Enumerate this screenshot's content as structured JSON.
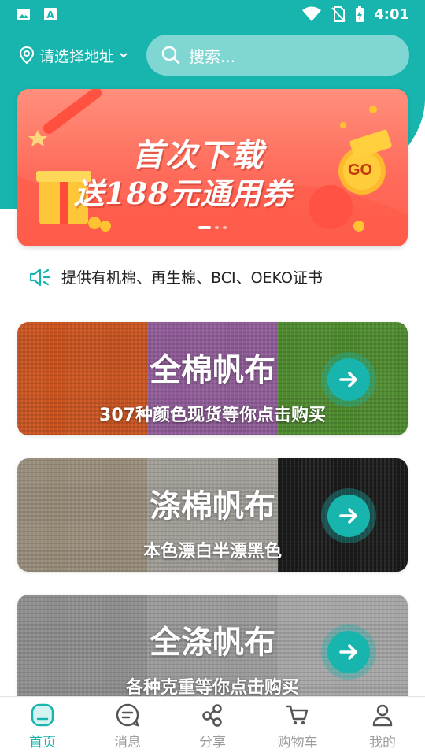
{
  "status_bar": {
    "time": "4:01"
  },
  "header": {
    "location_label": "请选择地址",
    "search_placeholder": "搜索..."
  },
  "banner": {
    "line1": "首次下载",
    "line2": "送188元通用券",
    "badge": "GO",
    "slide_count": 3,
    "active_slide": 0
  },
  "notice": {
    "text": "提供有机棉、再生棉、BCI、OEKO证书"
  },
  "cards": [
    {
      "title": "全棉帆布",
      "subtitle": "307种颜色现货等你点击购买",
      "swatches": [
        "#c9531f",
        "#8e5b97",
        "#4e8a2e"
      ]
    },
    {
      "title": "涤棉帆布",
      "subtitle": "本色漂白半漂黑色",
      "swatches": [
        "#978c7a",
        "#a09d97",
        "#1a1a1a"
      ]
    },
    {
      "title": "全涤帆布",
      "subtitle": "各种克重等你点击购买",
      "swatches": [
        "#8d8d8d",
        "#999999",
        "#a5a5a5"
      ]
    }
  ],
  "tabbar": {
    "items": [
      {
        "label": "首页",
        "icon": "home-icon",
        "active": true
      },
      {
        "label": "消息",
        "icon": "message-icon",
        "active": false
      },
      {
        "label": "分享",
        "icon": "share-icon",
        "active": false
      },
      {
        "label": "购物车",
        "icon": "cart-icon",
        "active": false
      },
      {
        "label": "我的",
        "icon": "profile-icon",
        "active": false
      }
    ]
  },
  "colors": {
    "accent": "#17b5ad",
    "inactive": "#9b9b9b"
  }
}
